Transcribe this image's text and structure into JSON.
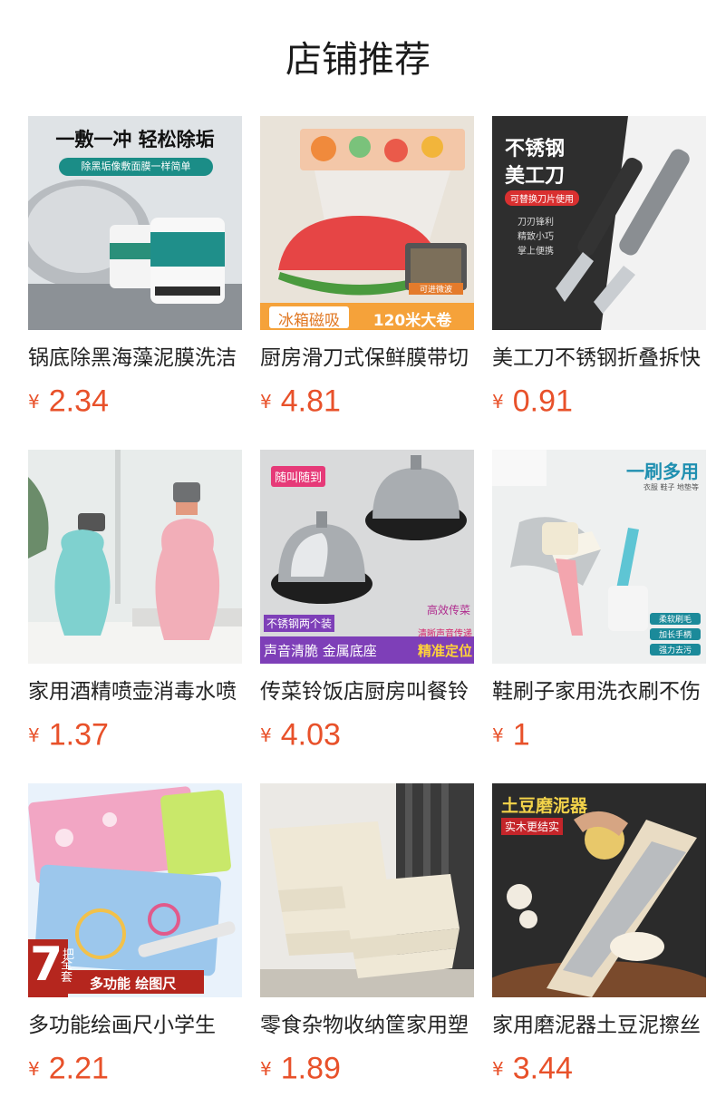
{
  "section": {
    "title": "店铺推荐"
  },
  "currency_symbol": "¥",
  "products": [
    {
      "name": "锅底除黑海藻泥膜洗洁",
      "price": "2.34",
      "image_texts": {
        "headline": "一敷一冲 轻松除垢",
        "banner": "除黑垢像敷面膜一样简单"
      }
    },
    {
      "name": "厨房滑刀式保鲜膜带切",
      "price": "4.81",
      "image_texts": {
        "tag_left": "冰箱磁吸",
        "tag_right": "120米大卷",
        "badge": "可进微波"
      }
    },
    {
      "name": "美工刀不锈钢折叠拆快",
      "price": "0.91",
      "image_texts": {
        "line1": "不锈钢",
        "line2": "美工刀",
        "pill": "可替换刀片使用",
        "feat1": "刀刃锋利",
        "feat2": "精致小巧",
        "feat3": "掌上便携"
      }
    },
    {
      "name": "家用酒精喷壶消毒水喷",
      "price": "1.37",
      "image_texts": {}
    },
    {
      "name": "传菜铃饭店厨房叫餐铃",
      "price": "4.03",
      "image_texts": {
        "corner": "随叫随到",
        "right1": "高效传菜",
        "label": "不锈钢两个装",
        "right2": "清晰声音传递",
        "bottom_left": "声音清脆 金属底座",
        "bottom_right": "精准定位"
      }
    },
    {
      "name": "鞋刷子家用洗衣刷不伤",
      "price": "1",
      "image_texts": {
        "headline": "一刷多用",
        "sub": "衣服 鞋子 地垫等",
        "tag1": "柔软刷毛",
        "tag2": "加长手柄",
        "tag3": "强力去污"
      }
    },
    {
      "name": "多功能绘画尺小学生",
      "price": "2.21",
      "image_texts": {
        "big_number": "7",
        "side1": "把",
        "side2": "全套",
        "banner": "多功能 绘图尺"
      }
    },
    {
      "name": "零食杂物收纳筐家用塑",
      "price": "1.89",
      "image_texts": {}
    },
    {
      "name": "家用磨泥器土豆泥擦丝",
      "price": "3.44",
      "image_texts": {
        "headline": "土豆磨泥器",
        "tag": "实木更结实"
      }
    }
  ]
}
